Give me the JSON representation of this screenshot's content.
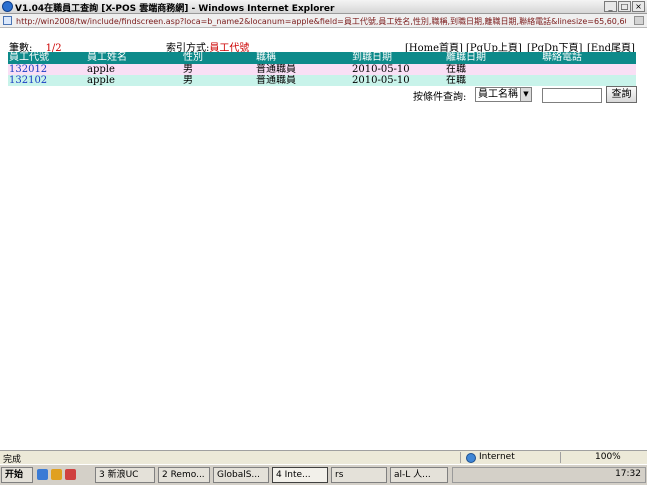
{
  "window": {
    "title": "V1.04在職員工查詢 [X-POS 雲端商務網] - Windows Internet Explorer",
    "url": "http://win2008/tw/include/findscreen.asp?loca=b_name2&locanum=apple&field=員工代號,員工姓名,性別,職稱,到職日期,離職日期,聯絡電話&linesize=65,60,60,60,80,80,80,80"
  },
  "page": {
    "count_label": "筆數:",
    "count_value": "1/2",
    "index_label": "索引方式:",
    "index_value": "員工代號",
    "nav": {
      "home": "[Home首頁]",
      "pgup": "[PgUp上頁]",
      "pgdn": "[PgDn下頁]",
      "end": "[End尾頁]"
    },
    "columns": [
      "員工代號",
      "員工姓名",
      "性別",
      "職稱",
      "到職日期",
      "離職日期",
      "聯絡電話"
    ],
    "rows": [
      [
        "132012",
        "apple",
        "男",
        "普通職員",
        "2010-05-10",
        "在職",
        ""
      ],
      [
        "132102",
        "apple",
        "男",
        "普通職員",
        "2010-05-10",
        "在職",
        ""
      ]
    ],
    "query": {
      "label": "按條件查詢:",
      "field_selected": "員工名稱",
      "input_value": "",
      "button": "查詢"
    }
  },
  "status": {
    "text": "完成",
    "zone": "Internet",
    "zoom": "100%"
  },
  "taskbar": {
    "start": "开始",
    "tasks": [
      "3 新浪UC",
      "2 Remo...",
      "GlobalS...",
      "4 Inte...",
      "rs",
      "al-L 人..."
    ],
    "clock": "17:32"
  },
  "colors": {
    "header_bg": "#0d8a8a",
    "row_odd": "#f9dff5",
    "row_even": "#c8f3ea",
    "accent_red": "#cc0000"
  }
}
